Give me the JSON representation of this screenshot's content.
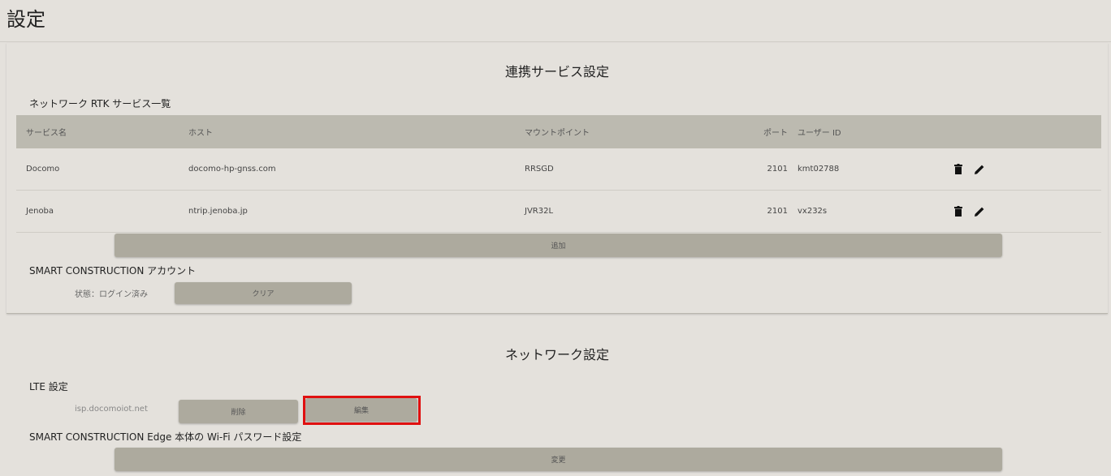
{
  "page": {
    "title": "設定"
  },
  "linked": {
    "title": "連携サービス設定",
    "rtk_title": "ネットワーク RTK サービス一覧",
    "columns": {
      "name": "サービス名",
      "host": "ホスト",
      "mount": "マウントポイント",
      "port": "ポート",
      "user": "ユーザー ID"
    },
    "rows": [
      {
        "name": "Docomo",
        "host": "docomo-hp-gnss.com",
        "mount": "RRSGD",
        "port": "2101",
        "user": "kmt02788"
      },
      {
        "name": "Jenoba",
        "host": "ntrip.jenoba.jp",
        "mount": "JVR32L",
        "port": "2101",
        "user": "vx232s"
      }
    ],
    "add_label": "追加",
    "account_title": "SMART CONSTRUCTION アカウント",
    "status_text": "状態：ログイン済み",
    "clear_label": "クリア"
  },
  "network": {
    "title": "ネットワーク設定",
    "lte_title": "LTE 設定",
    "apn": "isp.docomoiot.net",
    "delete_label": "削除",
    "edit_label": "編集",
    "wifi_title": "SMART CONSTRUCTION Edge 本体の Wi-Fi パスワード設定",
    "change_label": "変更"
  },
  "icons": {
    "delete": "trash-icon",
    "edit": "pencil-icon"
  },
  "colors": {
    "highlight": "#e01010",
    "button": "#adaa9e",
    "header": "#bcbab0"
  }
}
